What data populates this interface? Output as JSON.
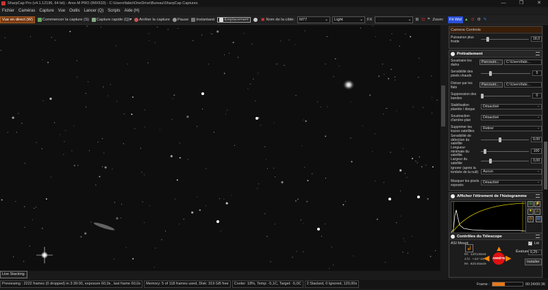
{
  "window": {
    "title": "SharpCap Pro (v4.1.12196, 64 bit) - Ares-M PRO (IMX533) - C:\\Users\\fabio\\OneDrive\\Bureau\\SharpCap Captures",
    "btn_min": "—",
    "btn_max": "❐",
    "btn_close": "✕"
  },
  "menu": [
    "Fichier",
    "Caméras",
    "Capture",
    "Vue",
    "Outils",
    "Lancer (Q)",
    "Scripts",
    "Aide (H)"
  ],
  "toolbar": {
    "live": "Vue en direct (W)",
    "start": "Commencer la capture (S)",
    "quick": "Capture rapide (Q)",
    "stop": "Arrêter la capture",
    "pause": "Pause",
    "snapshot": "Instantané",
    "framing": "Emplacement",
    "target_label": "Nom de la cible:",
    "target_value": "M77",
    "frame_type": "Light",
    "fx_label": "FX",
    "fx_value": "",
    "zoom_label": "Zoom:",
    "zoom_value": "Fit Wid"
  },
  "panel": {
    "camera_controls": {
      "title": "Camera Controls",
      "cold_label": "Puissance plus froide",
      "cold_value": "18,0"
    },
    "pretraitement": {
      "title": "Prétraitement",
      "darks_label": "Soustraire les darks",
      "darks_btn": "Parcourir...",
      "darks_path": "C:\\Users\\fabi...",
      "hot_label": "Sensibilité des pixels chauds",
      "hot_value": "5",
      "flats_label": "Diviser par les flats",
      "flats_btn": "Parcourir...",
      "flats_path": "C:\\Users\\fabi...",
      "bands_label": "Suppression des bandes",
      "bands_value": "0",
      "stab_label": "Stabilisation planète / disque",
      "stab_value": "Désactivé",
      "bg_label": "Soustraction d'arrière-plan",
      "bg_value": "Désactivé",
      "sat_label": "Supprimer les traces satellites",
      "sat_value": "Retirer",
      "sens_label": "Sensibilité de détection du satellite",
      "sens_value": "9,00",
      "len_label": "Longueur minimale du satellite",
      "len_value": "100",
      "width_label": "Largeur du satellite",
      "width_value": "3,00",
      "dawn_label": "Ignorer (après la tombée de la nuit)",
      "dawn_value": "Aucun",
      "mask_label": "Masquer les pixels exposés",
      "mask_value": "Désactivé"
    },
    "histogram": {
      "title": "Afficher l'étirement de l'histogramme"
    },
    "telescope": {
      "title": "Contrôles du Télescope",
      "mount": "ASI Mount",
      "link_label": "Lié",
      "eval_label": "Évaluer:",
      "eval_value": "0,25",
      "stop_label": "ARRÊTE",
      "install_label": "Installer",
      "ra": "RA  12h19m48",
      "alt": "Alt  +33°18'2",
      "az": "RA  02h45m49"
    }
  },
  "status": {
    "preview": "Previewing : 2222 frames (0 dropped) in 3:39:00, exposure 60,0s , last frame 60,0s",
    "memory": "Memory: 5 of 118 frames used, Disk: 319 GB free",
    "cooler": "Cooler: 18%, Temp: -5,1C, Target: -5,0C",
    "stacked": "2 Stacked, 0 Ignored, 120,00s",
    "frame_label": "Frame :",
    "frame_progress": 0.4,
    "time": "00:24/00:36"
  },
  "live_stacking": "Live Stacking",
  "colors": {
    "accent": "#e87818",
    "zoom": "#2a4fd8",
    "stop": "#e01010"
  }
}
